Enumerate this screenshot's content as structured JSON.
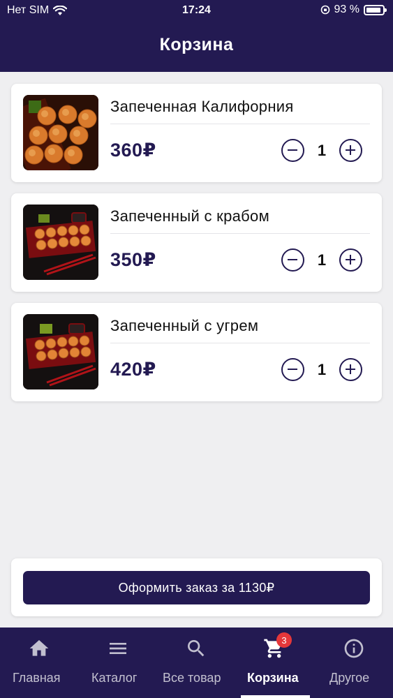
{
  "status_bar": {
    "carrier": "Нет SIM",
    "time": "17:24",
    "battery": "93 %",
    "battery_level": 0.93
  },
  "header": {
    "title": "Корзина"
  },
  "cart": {
    "items": [
      {
        "name": "Запеченная Калифорния",
        "price": "360₽",
        "quantity": "1"
      },
      {
        "name": "Запеченный с крабом",
        "price": "350₽",
        "quantity": "1"
      },
      {
        "name": "Запеченный с угрем",
        "price": "420₽",
        "quantity": "1"
      }
    ],
    "order_button_label": "Оформить заказ за 1130₽"
  },
  "tabbar": {
    "tabs": [
      {
        "label": "Главная",
        "icon": "home-icon"
      },
      {
        "label": "Каталог",
        "icon": "menu-icon"
      },
      {
        "label": "Все товар",
        "icon": "search-icon"
      },
      {
        "label": "Корзина",
        "icon": "cart-icon",
        "active": true
      },
      {
        "label": "Другое",
        "icon": "info-icon"
      }
    ],
    "cart_badge": "3"
  },
  "colors": {
    "primary": "#231a52",
    "background": "#efeff1",
    "badge": "#e5373a"
  }
}
